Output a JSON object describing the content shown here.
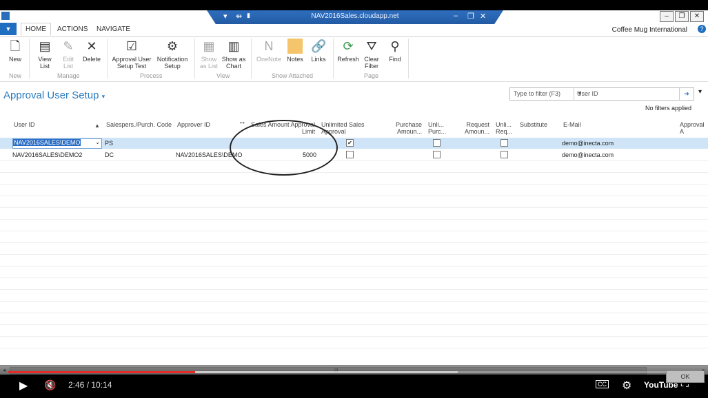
{
  "window": {
    "host": "NAV2016Sales.cloudapp.net"
  },
  "ribbon_tabs": [
    "HOME",
    "ACTIONS",
    "NAVIGATE"
  ],
  "company": "Coffee Mug International",
  "ribbon": {
    "new": "New",
    "view_list": [
      "View",
      "List"
    ],
    "edit_list": [
      "Edit",
      "List"
    ],
    "delete": "Delete",
    "approval_test": [
      "Approval User",
      "Setup Test"
    ],
    "notification": [
      "Notification",
      "Setup"
    ],
    "show_list": [
      "Show",
      "as List"
    ],
    "show_chart": [
      "Show as",
      "Chart"
    ],
    "onenote": "OneNote",
    "notes": "Notes",
    "links": "Links",
    "refresh": "Refresh",
    "clear_filter": [
      "Clear",
      "Filter"
    ],
    "find": "Find",
    "groups": [
      "New",
      "Manage",
      "Process",
      "View",
      "Show Attached",
      "Page"
    ]
  },
  "page": {
    "title": "Approval User Setup",
    "filter_placeholder": "Type to filter (F3)",
    "filter_field": "User ID",
    "no_filters": "No filters applied"
  },
  "columns": {
    "user_id": "User ID",
    "salesperson": "Salespers./Purch. Code",
    "approver": "Approver ID",
    "sales_limit": [
      "Sales Amount Approval",
      "Limit"
    ],
    "unlimited_sales": [
      "Unlimited Sales",
      "Approval"
    ],
    "purchase_amount": [
      "Purchase",
      "Amoun..."
    ],
    "unlimited_purch": [
      "Unli...",
      "Purc..."
    ],
    "request_amount": [
      "Request",
      "Amoun..."
    ],
    "unlimited_req": [
      "Unli...",
      "Req..."
    ],
    "substitute": "Substitute",
    "email": "E-Mail",
    "approval_admin": "Approval A"
  },
  "rows": [
    {
      "user_id": "NAV2016SALES\\DEMO",
      "salesperson": "PS",
      "approver": "",
      "sales_limit": "",
      "unlimited_sales": true,
      "unlimited_purch": false,
      "unlimited_req": false,
      "email": "demo@inecta.com"
    },
    {
      "user_id": "NAV2016SALES\\DEMO2",
      "salesperson": "DC",
      "approver": "NAV2016SALES\\DEMO",
      "sales_limit": "5000",
      "unlimited_sales": false,
      "unlimited_purch": false,
      "unlimited_req": false,
      "email": "demo@inecta.com"
    }
  ],
  "player": {
    "time": "2:46 / 10:14",
    "progress_fraction": 0.27,
    "buffered_fraction": 0.65,
    "ok_label": "OK",
    "cc": "CC",
    "brand": "YouTube"
  },
  "colors": {
    "accent": "#2a7bbf",
    "selection": "#cfe4f7",
    "progress": "#e52d27"
  }
}
